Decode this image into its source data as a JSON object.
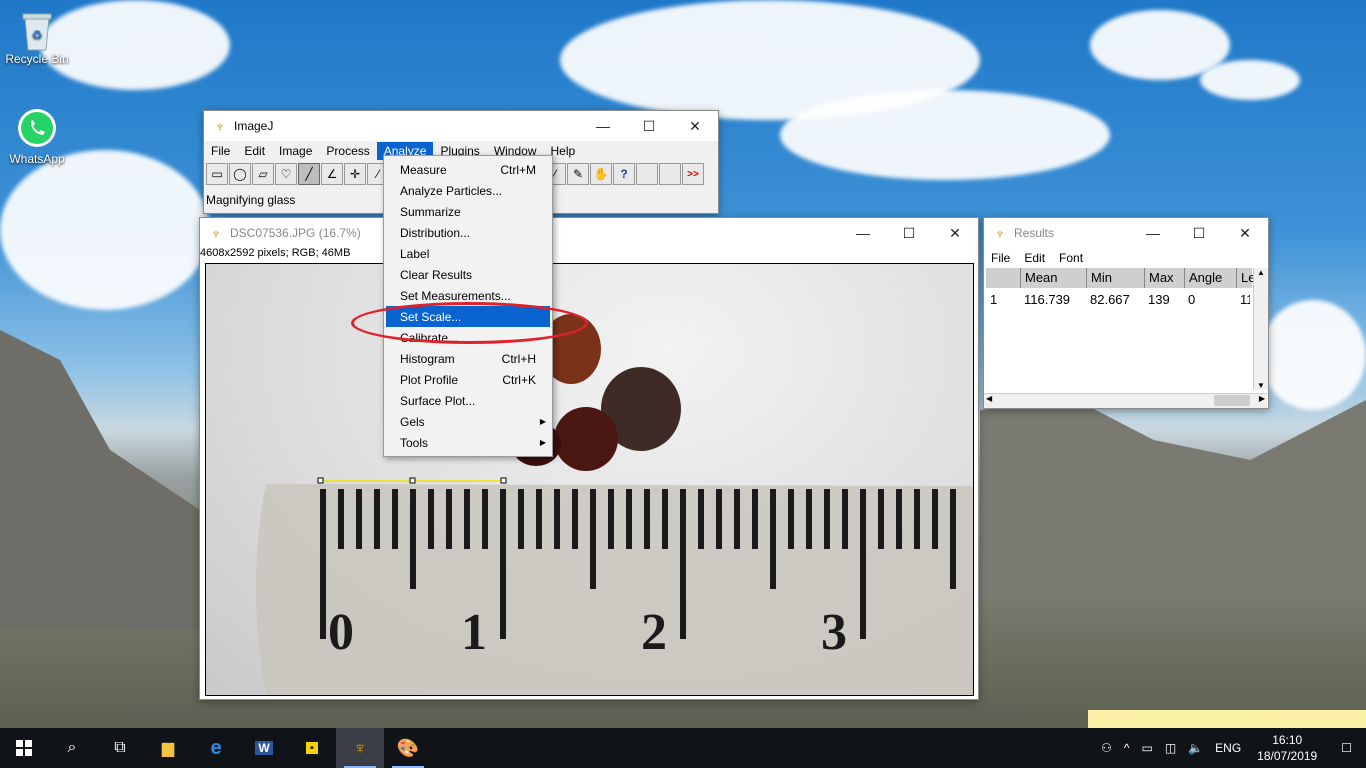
{
  "desktop": {
    "icons": [
      {
        "label": "Recycle Bin",
        "icon": "recycle-bin-icon"
      },
      {
        "label": "WhatsApp",
        "icon": "whatsapp-icon"
      }
    ]
  },
  "imagej": {
    "title": "ImageJ",
    "menus": [
      "File",
      "Edit",
      "Image",
      "Process",
      "Analyze",
      "Plugins",
      "Window",
      "Help"
    ],
    "active_menu": "Analyze",
    "status": "Magnifying glass",
    "more_tools": ">>"
  },
  "analyze_menu": {
    "items": [
      {
        "label": "Measure",
        "shortcut": "Ctrl+M"
      },
      {
        "label": "Analyze Particles...",
        "shortcut": ""
      },
      {
        "label": "Summarize",
        "shortcut": ""
      },
      {
        "label": "Distribution...",
        "shortcut": ""
      },
      {
        "label": "Label",
        "shortcut": ""
      },
      {
        "label": "Clear Results",
        "shortcut": ""
      },
      {
        "label": "Set Measurements...",
        "shortcut": ""
      },
      {
        "label": "Set Scale...",
        "shortcut": "",
        "selected": true
      },
      {
        "label": "Calibrate...",
        "shortcut": ""
      },
      {
        "label": "Histogram",
        "shortcut": "Ctrl+H"
      },
      {
        "label": "Plot Profile",
        "shortcut": "Ctrl+K"
      },
      {
        "label": "Surface Plot...",
        "shortcut": ""
      },
      {
        "label": "Gels",
        "shortcut": "",
        "submenu": true
      },
      {
        "label": "Tools",
        "shortcut": "",
        "submenu": true
      }
    ]
  },
  "image_window": {
    "title": "DSC07536.JPG (16.7%)",
    "info": "4608x2592 pixels; RGB; 46MB",
    "ruler_numbers": [
      "0",
      "1",
      "2",
      "3"
    ]
  },
  "results": {
    "title": "Results",
    "menus": [
      "File",
      "Edit",
      "Font"
    ],
    "columns": [
      "",
      "Mean",
      "Min",
      "Max",
      "Angle",
      "Le"
    ],
    "rows": [
      [
        "1",
        "116.739",
        "82.667",
        "139",
        "0",
        "11"
      ]
    ]
  },
  "taskbar": {
    "lang": "ENG",
    "time": "16:10",
    "date": "18/07/2019"
  },
  "colors": {
    "menu_highlight": "#0a64d0",
    "annotation_red": "#e0202a"
  }
}
